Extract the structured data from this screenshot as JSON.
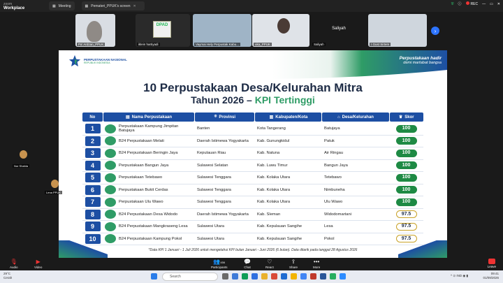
{
  "app": {
    "brand_top": "zoom",
    "brand_bottom": "Workplace"
  },
  "tabs": [
    {
      "label": "Meeting"
    },
    {
      "label": "Pemateri_PPUK's screen"
    }
  ],
  "top_right": {
    "rec": "REC"
  },
  "participants": [
    {
      "name": "Pa' Ardzan_PPUK"
    },
    {
      "name": "iklein hartiyadi"
    },
    {
      "name": "Vaymai Hely Perpustak Kabu..."
    },
    {
      "name": "uka_PPUK"
    },
    {
      "name": "Saliyah"
    },
    {
      "name": "I Gust Sirtem"
    }
  ],
  "slide": {
    "logo_line1": "PERPUSTAKAAN NASIONAL",
    "logo_line2": "REPUBLIK INDONESIA",
    "tagline1": "Perpustakaan hadir",
    "tagline2": "demi martabat bangsa",
    "title": "10 Perpustakaan Desa/Kelurahan Mitra",
    "subtitle_year": "Tahun 2026 –",
    "subtitle_kpi": "KPI Tertinggi",
    "headers": {
      "no": "No",
      "nama": "Nama Perpustakaan",
      "provinsi": "Provinsi",
      "kab": "Kabupaten/Kota",
      "desa": "Desa/Kelurahan",
      "skor": "Skor"
    },
    "rows": [
      {
        "no": "1",
        "nama": "Perpustakaan Kampung Jimpitan Batujaya",
        "provinsi": "Banten",
        "kab": "Kota Tangerang",
        "desa": "Batujaya",
        "skor": "100",
        "tier": "g"
      },
      {
        "no": "2",
        "nama": "B24 Perpustakaan Melati",
        "provinsi": "Daerah Istimewa Yogyakarta",
        "kab": "Kab. Gunungkidul",
        "desa": "Patuk",
        "skor": "100",
        "tier": "g"
      },
      {
        "no": "3",
        "nama": "B24 Perpustakaan Beringin Jaya",
        "provinsi": "Kepulauan Riau",
        "kab": "Kab. Natuna",
        "desa": "Air Ringau",
        "skor": "100",
        "tier": "g"
      },
      {
        "no": "4",
        "nama": "Perpustakaan Bangun Jaya",
        "provinsi": "Sulawesi Selatan",
        "kab": "Kab. Luwu Timur",
        "desa": "Bangun Jaya",
        "skor": "100",
        "tier": "g"
      },
      {
        "no": "5",
        "nama": "Perpustakaan Tetebawo",
        "provinsi": "Sulawesi Tenggara",
        "kab": "Kab. Kolaka Utara",
        "desa": "Tetebawo",
        "skor": "100",
        "tier": "g"
      },
      {
        "no": "6",
        "nama": "Perpustakaan Bukit Cerdas",
        "provinsi": "Sulawesi Tenggara",
        "kab": "Kab. Kolaka Utara",
        "desa": "Nimbuneha",
        "skor": "100",
        "tier": "g"
      },
      {
        "no": "7",
        "nama": "Perpustakaan Ulu Wawo",
        "provinsi": "Sulawesi Tenggara",
        "kab": "Kab. Kolaka Utara",
        "desa": "Ulu Wawo",
        "skor": "100",
        "tier": "g"
      },
      {
        "no": "8",
        "nama": "B24 Perpustakaan Desa Widodo",
        "provinsi": "Daerah Istimewa Yogyakarta",
        "kab": "Kab. Sleman",
        "desa": "Widodomartani",
        "skor": "97.5",
        "tier": "o"
      },
      {
        "no": "9",
        "nama": "B24 Perpustakaan Mangkraseng Lesa",
        "provinsi": "Sulawesi Utara",
        "kab": "Kab. Kepulauan Sangihe",
        "desa": "Lesa",
        "skor": "97.5",
        "tier": "o"
      },
      {
        "no": "10",
        "nama": "B24 Perpustakaan Kampung Pokol",
        "provinsi": "Sulawesi Utara",
        "kab": "Kab. Kepulauan Sangihe",
        "desa": "Pokol",
        "skor": "97.5",
        "tier": "o"
      }
    ],
    "note": "*Data KPI 1 Januari - 1 Juli 2026 untuk mengetahui KPI bulan Januari - Juni 2026 (6 bulan). Data ditarik pada tanggal 28 Agustus 2026"
  },
  "side_names": {
    "a": "Nur Shahla",
    "b": "Lena PPUK"
  },
  "controls": {
    "audio": "Audio",
    "video": "Video",
    "participants": "Participants",
    "participants_count": "456",
    "chat": "Chat",
    "react": "React",
    "share": "Share",
    "more": "More",
    "leave": "Leave"
  },
  "taskbar": {
    "temp": "29°C",
    "weather": "Cerah",
    "search": "Search",
    "time": "09:41",
    "date": "01/09/2026",
    "lang": "IND"
  }
}
